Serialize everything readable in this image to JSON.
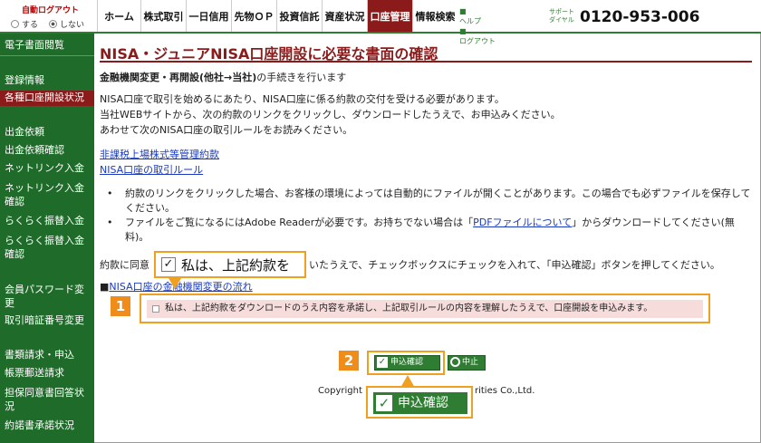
{
  "auto_logout": {
    "title": "自動ログアウト",
    "option_on": "する",
    "option_off": "しない",
    "selected": "しない"
  },
  "nav": [
    "ホーム",
    "株式取引",
    "一日信用",
    "先物ＯＰ",
    "投資信託",
    "資産状況",
    "口座管理",
    "情報検索"
  ],
  "nav_active": "口座管理",
  "help_links": [
    "ヘルプ",
    "ログアウト"
  ],
  "support": {
    "label1": "サポート",
    "label2": "ダイヤル",
    "phone": "0120-953-006"
  },
  "sidebar": {
    "items": [
      "電子書面閲覧",
      "登録情報",
      "各種口座開設状況",
      "出金依頼",
      "出金依頼確認",
      "ネットリンク入金",
      "ネットリンク入金確認",
      "らくらく振替入金",
      "らくらく振替入金確認",
      "会員パスワード変更",
      "取引暗証番号変更",
      "書類請求・申込",
      "帳票郵送請求",
      "担保同意書回答状況",
      "約諾書承諾状況"
    ],
    "selected": "各種口座開設状況"
  },
  "main": {
    "title": "NISA・ジュニアNISA口座開設に必要な書面の確認",
    "subtitle_bold": "金融機関変更・再開設(他社→当社)",
    "subtitle_rest": "の手続きを行います",
    "intro": [
      "NISA口座で取引を始めるにあたり、NISA口座に係る約款の交付を受ける必要があります。",
      "当社WEBサイトから、次の約款のリンクをクリックし、ダウンロードしたうえで、お申込みください。",
      "あわせて次のNISA口座の取引ルールをお読みください。"
    ],
    "links": [
      "非課税上場株式等管理約款",
      "NISA口座の取引ルール"
    ],
    "bullets": [
      "約款のリンクをクリックした場合、お客様の環境によっては自動的にファイルが開くことがあります。この場合でも必ずファイルを保存してください。",
      "ファイルをご覧になるにはAdobe Readerが必要です。お持ちでない場合は「",
      "PDFファイルについて",
      "」からダウンロードしてください(無料)。"
    ],
    "instruction_left": "約款に同意",
    "instruction_right": "いたうえで、チェックボックスにチェックを入れて、「申込確認」ボタンを押してください。",
    "flow_link_prefix": "■",
    "flow_link": "NISA口座の金融機関変更の流れ",
    "agree_text": "私は、上記約款をダウンロードのうえ内容を承諾し、上記取引ルールの内容を理解したうえで、口座開設を申込みます。",
    "apply_button": "申込確認",
    "cancel_button": "中止",
    "copyright_left": "Copyright",
    "copyright_right": "rities Co.,Ltd."
  },
  "callouts": {
    "step1": "1",
    "step1_text": "私は、上記約款を",
    "step2": "2",
    "step2_text": "申込確認"
  },
  "colors": {
    "brand_green": "#2f7d32",
    "sidebar_green": "#1f6b2a",
    "accent_red": "#8b1a1a",
    "callout_orange": "#f0a020"
  }
}
